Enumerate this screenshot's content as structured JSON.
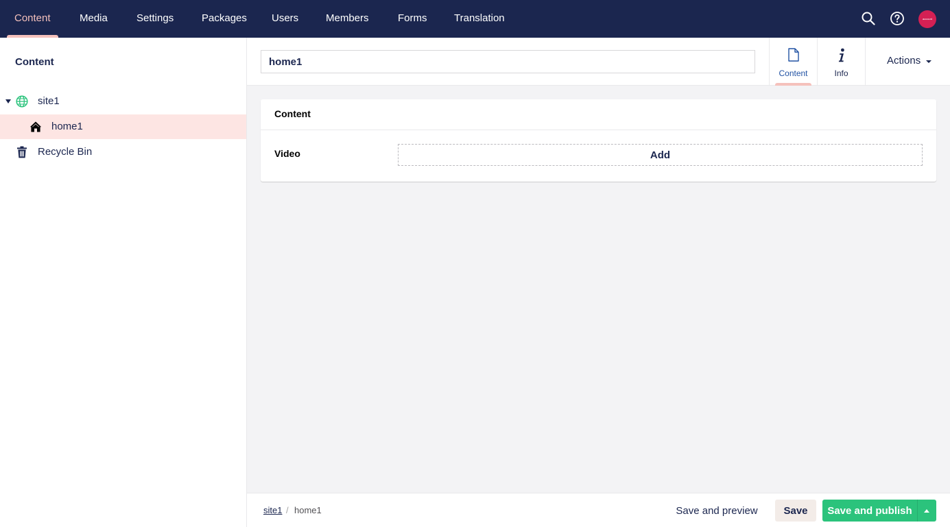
{
  "topnav": {
    "items": [
      {
        "label": "Content",
        "active": true
      },
      {
        "label": "Media"
      },
      {
        "label": "Settings"
      },
      {
        "label": "Packages"
      },
      {
        "label": "Users"
      },
      {
        "label": "Members"
      },
      {
        "label": "Forms"
      },
      {
        "label": "Translation"
      }
    ],
    "icons": [
      "search-icon",
      "help-icon"
    ],
    "avatar_text": "account"
  },
  "sidebar": {
    "title": "Content",
    "tree": [
      {
        "label": "site1",
        "icon": "globe-icon",
        "expanded": true
      },
      {
        "label": "home1",
        "icon": "home-icon",
        "selected": true
      },
      {
        "label": "Recycle Bin",
        "icon": "trash-icon"
      }
    ]
  },
  "editor": {
    "name_value": "home1",
    "apps": [
      {
        "label": "Content",
        "icon": "document-icon",
        "active": true
      },
      {
        "label": "Info",
        "icon": "info-icon"
      }
    ],
    "actions_label": "Actions"
  },
  "panel": {
    "title": "Content",
    "property_label": "Video",
    "add_label": "Add"
  },
  "footer": {
    "breadcrumb": [
      {
        "label": "site1",
        "link": true
      },
      {
        "label": "home1"
      }
    ],
    "separator": "/",
    "save_preview_label": "Save and preview",
    "save_label": "Save",
    "publish_label": "Save and publish"
  },
  "colors": {
    "topbar": "#1b264f",
    "active_accent": "#f5c1bc",
    "selected_row": "#fde5e3",
    "publish_green": "#2bc37c",
    "avatar": "#d42054",
    "globe": "#2bc37c"
  }
}
